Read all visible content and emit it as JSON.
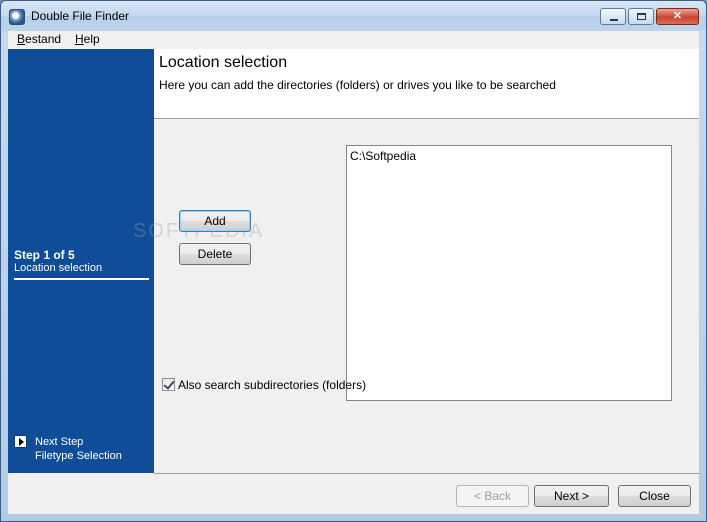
{
  "window": {
    "title": "Double File Finder"
  },
  "menu": {
    "items": [
      "Bestand",
      "Help"
    ]
  },
  "sidebar": {
    "step_title": "Step 1 of 5",
    "step_subtitle": "Location selection",
    "next_label": "Next Step",
    "next_target": "Filetype Selection"
  },
  "header": {
    "title": "Location selection",
    "subtitle": "Here you can add the directories (folders) or drives you like to be searched"
  },
  "buttons": {
    "add": "Add",
    "delete": "Delete",
    "back": "< Back",
    "next": "Next >",
    "close": "Close"
  },
  "locations": [
    "C:\\Softpedia"
  ],
  "options": {
    "subdirs_label": "Also search subdirectories (folders)",
    "subdirs_checked": true
  },
  "watermark": "SOFTPEDIA"
}
